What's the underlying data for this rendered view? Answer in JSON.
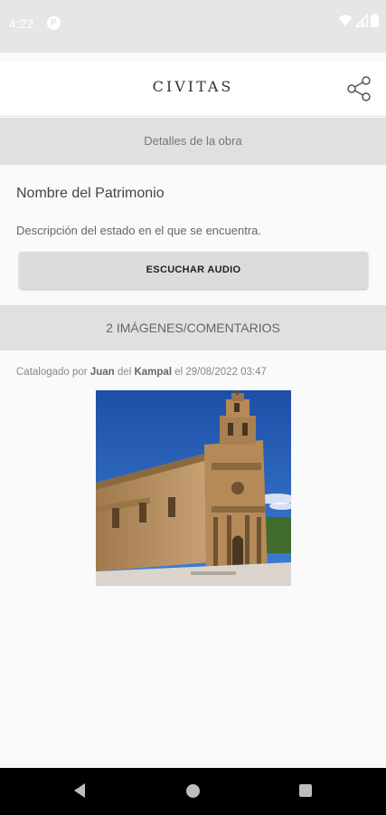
{
  "status_bar": {
    "time": "4:22",
    "notification_badge": "P",
    "icons": [
      "wifi-icon",
      "signal-icon",
      "battery-icon"
    ]
  },
  "app_bar": {
    "title": "CIVITAS",
    "share_icon": "share-icon"
  },
  "details_section": {
    "header": "Detalles de la obra"
  },
  "heritage": {
    "name": "Nombre del Patrimonio",
    "description": "Descripción del estado en el que se encuentra.",
    "audio_button_label": "ESCUCHAR AUDIO"
  },
  "images_section": {
    "header": "2 IMÁGENES/COMENTARIOS"
  },
  "catalog": {
    "prefix": "Catalogado por",
    "first_name": "Juan",
    "connector": "del",
    "last_name": "Kampal",
    "date_prefix": "el",
    "datetime": "29/08/2022 03:47"
  },
  "colors": {
    "section_header_bg": "#e0e0e0",
    "background": "#fafafa",
    "nav_bar": "#000000",
    "status_bar": "#e6e6e6"
  }
}
